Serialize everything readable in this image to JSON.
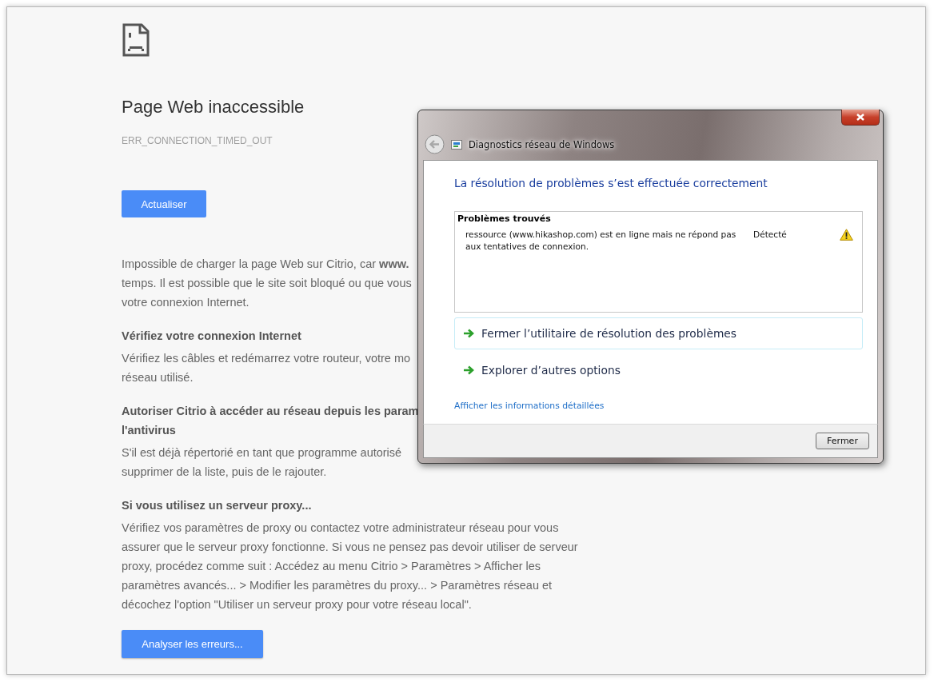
{
  "error_page": {
    "title": "Page Web inaccessible",
    "error_code": "ERR_CONNECTION_TIMED_OUT",
    "reload_button": "Actualiser",
    "blocks": [
      {
        "kind": "text",
        "lines": [
          "Impossible de charger la page Web sur Citrio, car **www.**",
          "temps. Il est possible que le site soit bloqué ou que vous",
          "votre connexion Internet."
        ]
      },
      {
        "kind": "heading",
        "lines": [
          "Vérifiez votre connexion Internet"
        ]
      },
      {
        "kind": "text",
        "lines": [
          "Vérifiez les câbles et redémarrez votre routeur, votre mo",
          "réseau utilisé."
        ]
      },
      {
        "kind": "heading",
        "lines": [
          "Autoriser Citrio à accéder au réseau depuis les param",
          "l'antivirus"
        ]
      },
      {
        "kind": "text",
        "lines": [
          "S'il est déjà répertorié en tant que programme autorisé",
          "supprimer de la liste, puis de le rajouter."
        ]
      },
      {
        "kind": "heading",
        "lines": [
          "Si vous utilisez un serveur proxy..."
        ]
      },
      {
        "kind": "text",
        "lines": [
          "Vérifiez vos paramètres de proxy ou contactez votre administrateur réseau pour vous",
          "assurer que le serveur proxy fonctionne. Si vous ne pensez pas devoir utiliser de serveur",
          "proxy, procédez comme suit : Accédez au menu Citrio > Paramètres > Afficher les",
          "paramètres avancés... > Modifier les paramètres du proxy... > Paramètres réseau et",
          "décochez l'option \"Utiliser un serveur proxy pour votre réseau local\"."
        ]
      }
    ],
    "analyze_button": "Analyser les erreurs..."
  },
  "dialog": {
    "title": "Diagnostics réseau de Windows",
    "heading": "La résolution de problèmes s’est effectuée correctement",
    "problems": {
      "title": "Problèmes trouvés",
      "rows": [
        {
          "description": "ressource (www.hikashop.com) est en ligne mais ne répond pas aux tentatives de connexion.",
          "status": "Détecté"
        }
      ]
    },
    "options": [
      {
        "label": "Fermer l’utilitaire de résolution des problèmes",
        "highlighted": true
      },
      {
        "label": "Explorer d’autres options",
        "highlighted": false
      }
    ],
    "details_link": "Afficher les informations détaillées",
    "close_button": "Fermer"
  }
}
